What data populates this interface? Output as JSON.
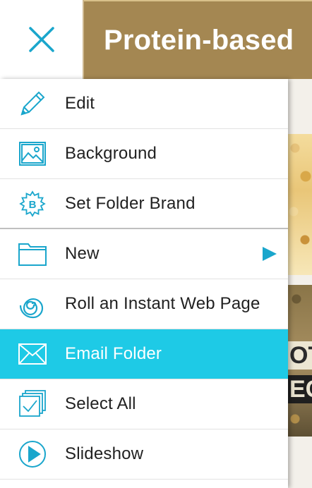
{
  "header": {
    "title": "Protein-based",
    "close_icon": "close-icon",
    "title_bar_color": "#a48752"
  },
  "background": {
    "visible_text_1": "OT",
    "visible_text_2": "EC"
  },
  "menu": {
    "accent_color": "#1ecae6",
    "icon_color": "#1aa6cc",
    "items": [
      {
        "label": "Edit",
        "icon": "pencil-icon"
      },
      {
        "label": "Background",
        "icon": "image-icon"
      },
      {
        "label": "Set Folder Brand",
        "icon": "brand-badge-icon"
      },
      {
        "label": "New",
        "icon": "folder-icon",
        "has_submenu": true
      },
      {
        "label": "Roll an Instant Web Page",
        "icon": "spiral-icon"
      },
      {
        "label": "Email Folder",
        "icon": "envelope-icon",
        "active": true
      },
      {
        "label": "Select All",
        "icon": "select-all-icon"
      },
      {
        "label": "Slideshow",
        "icon": "play-icon"
      }
    ]
  }
}
